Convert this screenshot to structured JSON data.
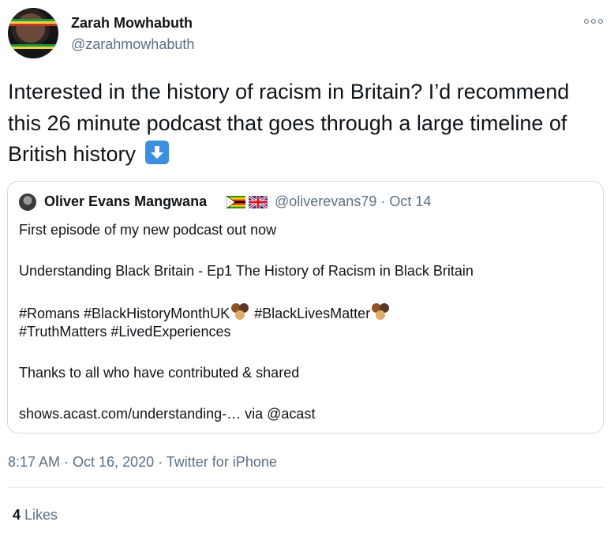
{
  "author": {
    "name": "Zarah Mowhabuth",
    "handle": "@zarahmowhabuth"
  },
  "tweet": {
    "text": "Interested in the history of racism in Britain? I’d recommend this 26 minute podcast that goes through a large timeline of British history",
    "emoji": "down-arrow-emoji"
  },
  "quoted": {
    "name": "Oliver Evans Mangwana",
    "flags": [
      "zimbabwe-flag",
      "uk-flag"
    ],
    "handle_date": "@oliverevans79 · Oct 14",
    "lines": {
      "l1": "First episode of my new podcast out now",
      "l2": "Understanding Black Britain - Ep1 The History of Racism in Black Britain",
      "l3a": "#Romans #BlackHistoryMonthUK",
      "l3b": "#BlackLivesMatter",
      "l4": "#TruthMatters #LivedExperiences",
      "l5": "Thanks to all who have contributed & shared",
      "l6": "shows.acast.com/understanding-… via @acast"
    }
  },
  "meta": {
    "time_date": "8:17 AM · Oct 16, 2020 ·",
    "source": "Twitter for iPhone"
  },
  "likes": {
    "count": "4",
    "label": "Likes"
  },
  "colors": {
    "text": "#0f1419",
    "secondary": "#5b7083",
    "border": "#cfd9de",
    "emoji_blue": "#3b8fde"
  }
}
